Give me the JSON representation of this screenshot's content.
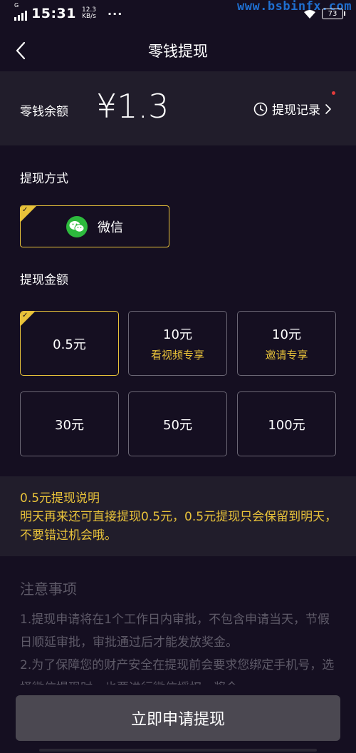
{
  "status_bar": {
    "carrier": "G",
    "time": "15:31",
    "net_speed_value": "12.3",
    "net_speed_unit": "KB/s",
    "more": "···",
    "battery": "73",
    "watermark": "www.bsbinfx.com"
  },
  "nav": {
    "title": "零钱提现"
  },
  "balance": {
    "label": "零钱余额",
    "amount": "¥1.3",
    "records_label": "提现记录",
    "records_has_new": true
  },
  "method": {
    "section_label": "提现方式",
    "option_label": "微信",
    "selected": true
  },
  "amounts": {
    "section_label": "提现金额",
    "options": [
      {
        "label": "0.5元",
        "sub": "",
        "selected": true
      },
      {
        "label": "10元",
        "sub": "看视频专享",
        "selected": false
      },
      {
        "label": "10元",
        "sub": "邀请专享",
        "selected": false
      },
      {
        "label": "30元",
        "sub": "",
        "selected": false
      },
      {
        "label": "50元",
        "sub": "",
        "selected": false
      },
      {
        "label": "100元",
        "sub": "",
        "selected": false
      }
    ]
  },
  "tip": {
    "title": "0.5元提现说明",
    "body": "明天再来还可直接提现0.5元，0.5元提现只会保留到明天，不要错过机会哦。"
  },
  "notes": {
    "title": "注意事项",
    "items": [
      "1.提现申请将在1个工作日内审批，不包含申请当天，节假日顺延审批，审批通过后才能发放奖金。",
      "2.为了保障您的财产安全在提现前会要求您绑定手机号，选择微信提现时，也要进行微信授权，奖金"
    ]
  },
  "submit": {
    "label": "立即申请提现"
  },
  "colors": {
    "background": "#150f21",
    "panel": "#211d2b",
    "accent": "#e8c23a",
    "wechat_green": "#2dba3d",
    "badge_red": "#e53b3b",
    "button": "#4b4851"
  }
}
